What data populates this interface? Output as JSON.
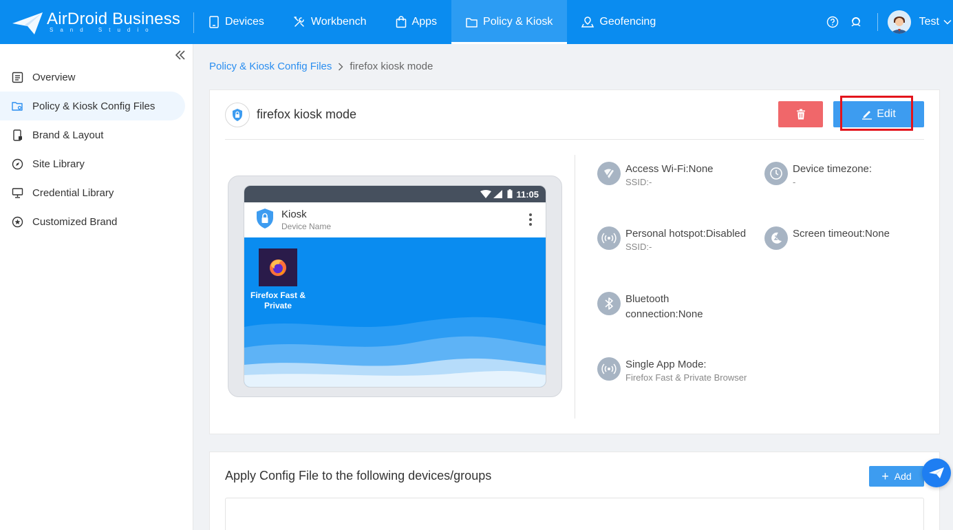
{
  "brand": {
    "name": "AirDroid Business",
    "tagline": "Sand Studio",
    "color": "#0a8cf0"
  },
  "nav": {
    "items": [
      {
        "label": "Devices",
        "icon": "tablet-icon"
      },
      {
        "label": "Workbench",
        "icon": "tools-icon"
      },
      {
        "label": "Apps",
        "icon": "bag-icon"
      },
      {
        "label": "Policy & Kiosk",
        "icon": "folder-icon",
        "active": true
      },
      {
        "label": "Geofencing",
        "icon": "map-pin-icon"
      }
    ]
  },
  "user": {
    "name": "Test"
  },
  "sidebar": {
    "items": [
      {
        "label": "Overview",
        "icon": "list-icon"
      },
      {
        "label": "Policy & Kiosk Config Files",
        "icon": "folder-settings-icon",
        "active": true
      },
      {
        "label": "Brand & Layout",
        "icon": "phone-layout-icon"
      },
      {
        "label": "Site Library",
        "icon": "compass-icon"
      },
      {
        "label": "Credential Library",
        "icon": "monitor-icon"
      },
      {
        "label": "Customized Brand",
        "icon": "star-circle-icon"
      }
    ]
  },
  "breadcrumb": {
    "parent": "Policy & Kiosk Config Files",
    "current": "firefox kiosk mode"
  },
  "config": {
    "title": "firefox kiosk mode",
    "edit_label": "Edit",
    "accent": "#3d9cf0",
    "danger": "#f0676a"
  },
  "preview": {
    "time": "11:05",
    "kiosk_title": "Kiosk",
    "kiosk_subtitle": "Device Name",
    "app_label": "Firefox Fast & Private Browser"
  },
  "settings": {
    "wifi": {
      "label": "Access Wi-Fi:None",
      "sub": "SSID:-"
    },
    "hotspot": {
      "label": "Personal hotspot:Disabled",
      "sub": "SSID:-"
    },
    "bluetooth": {
      "label": "Bluetooth connection:None"
    },
    "single_app": {
      "label": "Single App Mode:",
      "sub": "Firefox Fast & Private Browser"
    },
    "timezone": {
      "label": "Device timezone:",
      "sub": "-"
    },
    "screen_timeout": {
      "label": "Screen timeout:None"
    }
  },
  "apply": {
    "title": "Apply Config File to the following devices/groups",
    "add_label": "Add"
  }
}
